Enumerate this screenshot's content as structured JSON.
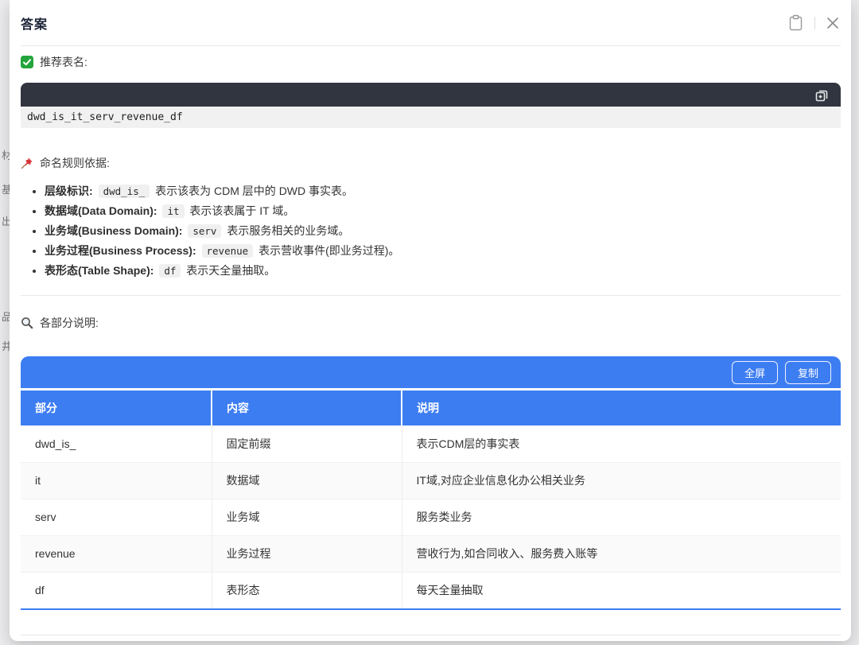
{
  "colors": {
    "accent_blue": "#3d7df2",
    "code_header_bg": "#30353f",
    "code_body_bg": "#f1f1f2",
    "inline_code_bg": "#f0f0f1",
    "title_text": "#1c2437"
  },
  "icons": {
    "header_copy": "clipboard-icon",
    "header_close": "close-icon",
    "recommend": "check-icon",
    "naming": "pin-icon",
    "parts": "magnifier-icon",
    "code_copy": "copy-icon"
  },
  "page_behind": {
    "left_fragments": [
      "材",
      "基",
      "出",
      "品",
      "井"
    ]
  },
  "modal": {
    "title": "答案"
  },
  "recommend": {
    "label": "推荐表名:",
    "code": "dwd_is_it_serv_revenue_df"
  },
  "naming": {
    "label": "命名规则依据:",
    "rules": [
      {
        "label": "层级标识:",
        "code": "dwd_is_",
        "desc": "表示该表为 CDM 层中的 DWD 事实表。"
      },
      {
        "label": "数据域(Data Domain):",
        "code": "it",
        "desc": "表示该表属于 IT 域。"
      },
      {
        "label": "业务域(Business Domain):",
        "code": "serv",
        "desc": "表示服务相关的业务域。"
      },
      {
        "label": "业务过程(Business Process):",
        "code": "revenue",
        "desc": "表示营收事件(即业务过程)。"
      },
      {
        "label": "表形态(Table Shape):",
        "code": "df",
        "desc": "表示天全量抽取。"
      }
    ]
  },
  "parts": {
    "label": "各部分说明:",
    "toolbar": {
      "fullscreen": "全屏",
      "copy": "复制"
    },
    "columns": [
      "部分",
      "内容",
      "说明"
    ],
    "rows": [
      [
        "dwd_is_",
        "固定前缀",
        "表示CDM层的事实表"
      ],
      [
        "it",
        "数据域",
        "IT域,对应企业信息化办公相关业务"
      ],
      [
        "serv",
        "业务域",
        "服务类业务"
      ],
      [
        "revenue",
        "业务过程",
        "营收行为,如合同收入、服务费入账等"
      ],
      [
        "df",
        "表形态",
        "每天全量抽取"
      ]
    ]
  }
}
